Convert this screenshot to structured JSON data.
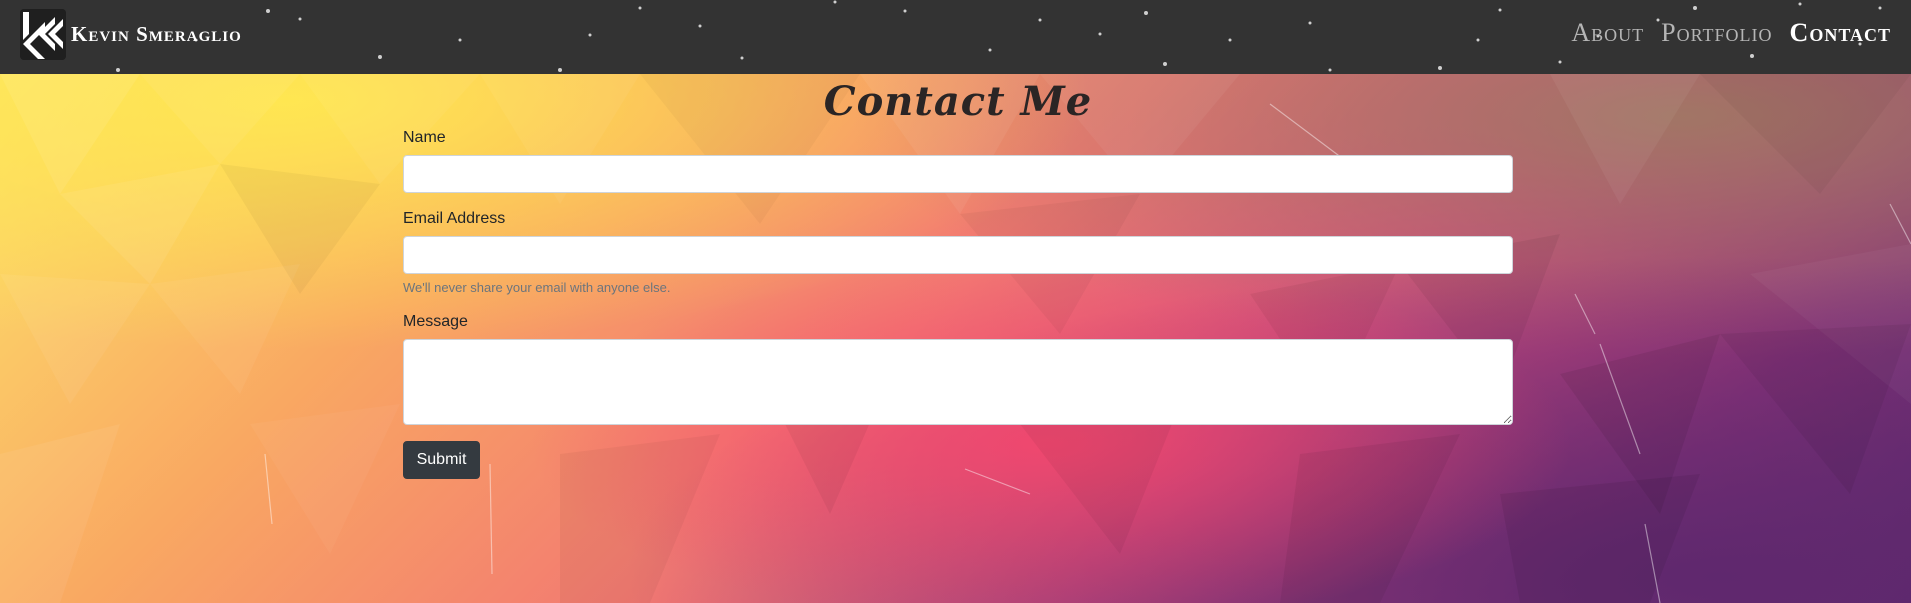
{
  "navbar": {
    "brand_name": "Kevin Smeraglio",
    "logo_icon": "kevin-smeraglio-logo-icon",
    "links": [
      {
        "label": "About",
        "active": false
      },
      {
        "label": "Portfolio",
        "active": false
      },
      {
        "label": "Contact",
        "active": true
      }
    ]
  },
  "page": {
    "title": "Contact Me"
  },
  "form": {
    "name_label": "Name",
    "name_value": "",
    "email_label": "Email Address",
    "email_value": "",
    "email_help": "We'll never share your email with anyone else.",
    "message_label": "Message",
    "message_value": "",
    "submit_label": "Submit"
  },
  "colors": {
    "navbar_bg": "#333333",
    "nav_link_inactive": "#b5b5b5",
    "nav_link_active": "#ffffff",
    "title_text": "#2a2525",
    "submit_bg": "#343a40"
  }
}
